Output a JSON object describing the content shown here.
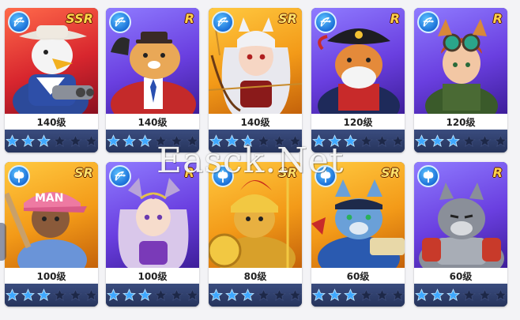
{
  "watermark": "Easck.Net",
  "heroes": [
    {
      "level": "140级",
      "rarity": "SSR",
      "class_icon": "bow-icon",
      "stars": 3,
      "subject": "eagle-cowboy"
    },
    {
      "level": "140级",
      "rarity": "R",
      "class_icon": "bow-icon",
      "stars": 3,
      "subject": "fat-cat-suit"
    },
    {
      "level": "140级",
      "rarity": "SR",
      "class_icon": "bow-icon",
      "stars": 3,
      "subject": "white-hair-archer"
    },
    {
      "level": "120级",
      "rarity": "R",
      "class_icon": "bow-icon",
      "stars": 3,
      "subject": "pirate-cat"
    },
    {
      "level": "120级",
      "rarity": "R",
      "class_icon": "bow-icon",
      "stars": 3,
      "subject": "goggles-girl"
    },
    {
      "level": "100级",
      "rarity": "SR",
      "class_icon": "axe-icon",
      "stars": 3,
      "subject": "cap-girl"
    },
    {
      "level": "100级",
      "rarity": "R",
      "class_icon": "bow-icon",
      "stars": 3,
      "subject": "purple-elf-girl"
    },
    {
      "level": "80级",
      "rarity": "SR",
      "class_icon": "axe-icon",
      "stars": 3,
      "subject": "golden-warrior-cat"
    },
    {
      "level": "60级",
      "rarity": "SR",
      "class_icon": "axe-icon",
      "stars": 3,
      "subject": "blue-warrior-cat"
    },
    {
      "level": "60级",
      "rarity": "R",
      "class_icon": "axe-icon",
      "stars": 3,
      "subject": "armored-grey-cat"
    }
  ],
  "colors": {
    "star_lit": "#3fa8ff",
    "star_dim": "#1d2848",
    "card_bg": "#2b3a64",
    "badge": "#1b70d8"
  }
}
